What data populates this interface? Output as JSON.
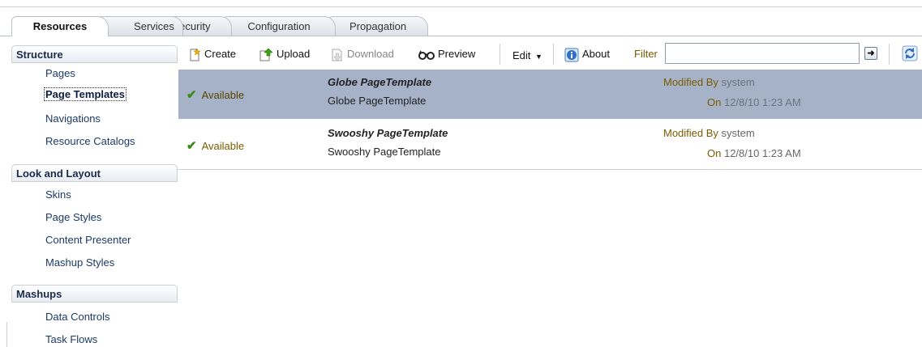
{
  "tabs": [
    {
      "label": "Resources",
      "active": true
    },
    {
      "label": "Services",
      "active": false
    },
    {
      "label": "Security",
      "active": false
    },
    {
      "label": "Configuration",
      "active": false
    },
    {
      "label": "Propagation",
      "active": false
    }
  ],
  "sidebar": {
    "sections": [
      {
        "header": "Structure",
        "items": [
          "Pages",
          "Page Templates",
          "Navigations",
          "Resource Catalogs"
        ],
        "selected": "Page Templates"
      },
      {
        "header": "Look and Layout",
        "items": [
          "Skins",
          "Page Styles",
          "Content Presenter",
          "Mashup Styles"
        ]
      },
      {
        "header": "Mashups",
        "items": [
          "Data Controls",
          "Task Flows"
        ]
      }
    ]
  },
  "toolbar": {
    "create": "Create",
    "upload": "Upload",
    "download": "Download",
    "preview": "Preview",
    "edit": "Edit",
    "about": "About",
    "filter_label": "Filter",
    "filter_value": ""
  },
  "rows": [
    {
      "status": "Available",
      "title": "Globe PageTemplate",
      "description": "Globe PageTemplate",
      "modified_by_label": "Modified By",
      "modified_by": "system",
      "on_label": "On",
      "date": "12/8/10 1:23 AM",
      "selected": true
    },
    {
      "status": "Available",
      "title": "Swooshy PageTemplate",
      "description": "Swooshy PageTemplate",
      "modified_by_label": "Modified By",
      "modified_by": "system",
      "on_label": "On",
      "date": "12/8/10 1:23 AM",
      "selected": false
    }
  ],
  "colors": {
    "selected_row": "#a5b2c8",
    "accent_text": "#7a5c00",
    "link": "#1a3a66"
  },
  "icons": [
    "create-icon",
    "upload-icon",
    "download-icon",
    "preview-glasses-icon",
    "chevron-down-icon",
    "about-icon",
    "go-arrow-icon",
    "refresh-icon",
    "checkmark-icon"
  ]
}
